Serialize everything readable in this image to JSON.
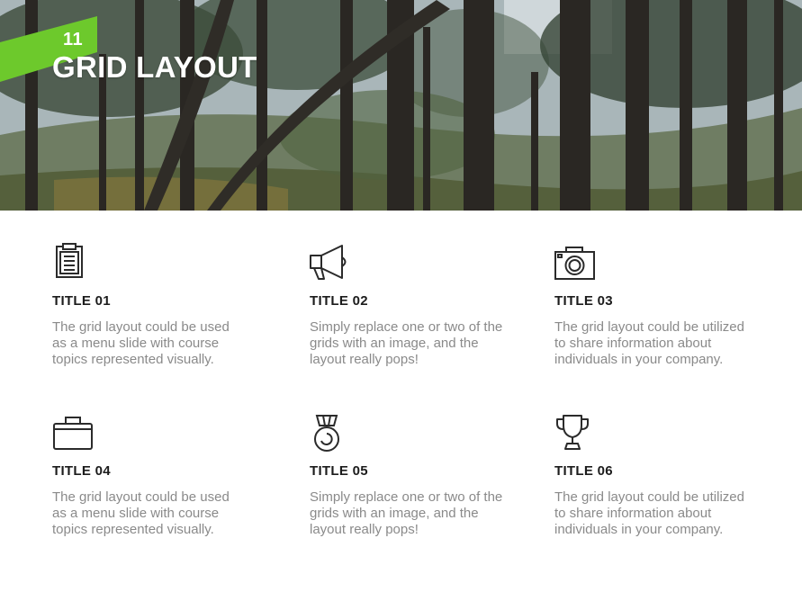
{
  "header": {
    "slide_number": "11",
    "title": "GRID LAYOUT",
    "accent_color": "#6dc92c"
  },
  "grid": {
    "items": [
      {
        "icon": "clipboard-icon",
        "title": "TITLE 01",
        "text": "The grid layout could be used as a menu slide with course topics represented visually."
      },
      {
        "icon": "megaphone-icon",
        "title": "TITLE 02",
        "text": "Simply replace one or two of the grids with an image, and the layout really pops!"
      },
      {
        "icon": "camera-icon",
        "title": "TITLE 03",
        "text": "The grid layout could be utilized to share information about individuals in your company."
      },
      {
        "icon": "briefcase-icon",
        "title": "TITLE 04",
        "text": "The grid layout could be used as a menu slide with course topics represented visually."
      },
      {
        "icon": "medal-icon",
        "title": "TITLE 05",
        "text": "Simply replace one or two of the grids with an image, and the layout really pops!"
      },
      {
        "icon": "trophy-icon",
        "title": "TITLE 06",
        "text": "The grid layout could be utilized to share information about individuals in your company."
      }
    ]
  }
}
